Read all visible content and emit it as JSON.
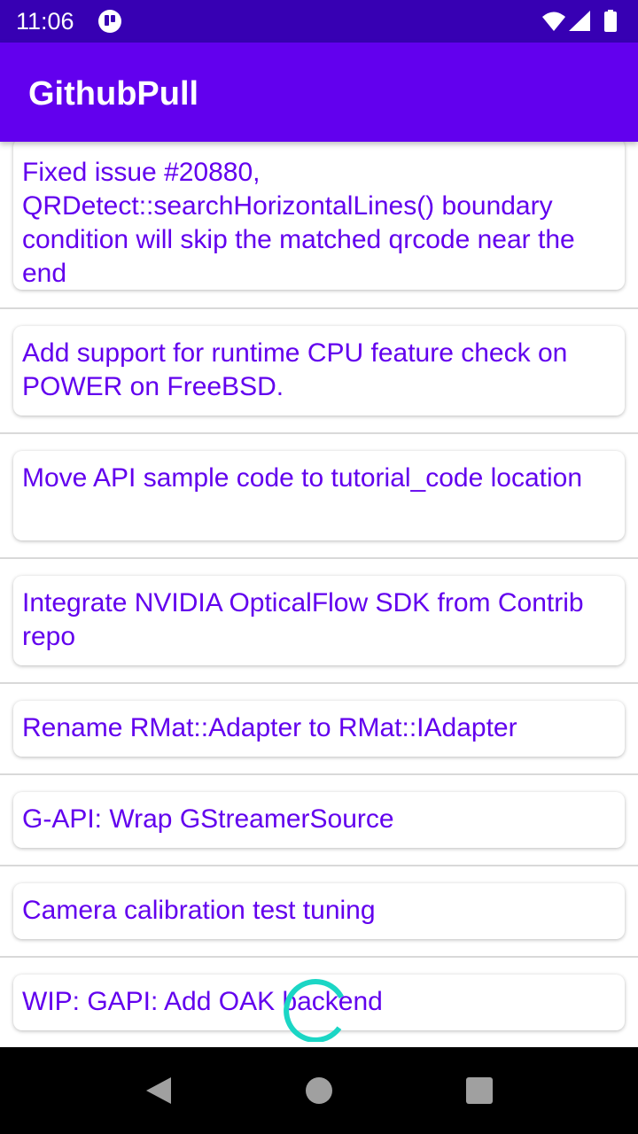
{
  "status_bar": {
    "time": "11:06",
    "icons": [
      "app-notification-icon",
      "wifi-icon",
      "cellular-signal-icon",
      "battery-icon"
    ]
  },
  "app_bar": {
    "title": "GithubPull"
  },
  "pull_requests": [
    "Fixed issue #20880, QRDetect::searchHorizontalLines() boundary condition will skip the matched qrcode near the end",
    "Add support for runtime CPU feature check on POWER on FreeBSD.",
    "Move API sample code to tutorial_code location",
    "Integrate NVIDIA OpticalFlow SDK from Contrib repo",
    "Rename RMat::Adapter to RMat::IAdapter",
    "G-API: Wrap GStreamerSource",
    "Camera calibration test tuning",
    "WIP: GAPI: Add OAK backend"
  ],
  "colors": {
    "status_bar": "#3700b3",
    "app_bar": "#6200ee",
    "item_text": "#6200ee",
    "spinner": "#1bd6c5"
  },
  "loading_indicator": "progress-spinner-icon",
  "nav_bar": {
    "icons": [
      "back-icon",
      "home-icon",
      "recents-icon"
    ]
  }
}
